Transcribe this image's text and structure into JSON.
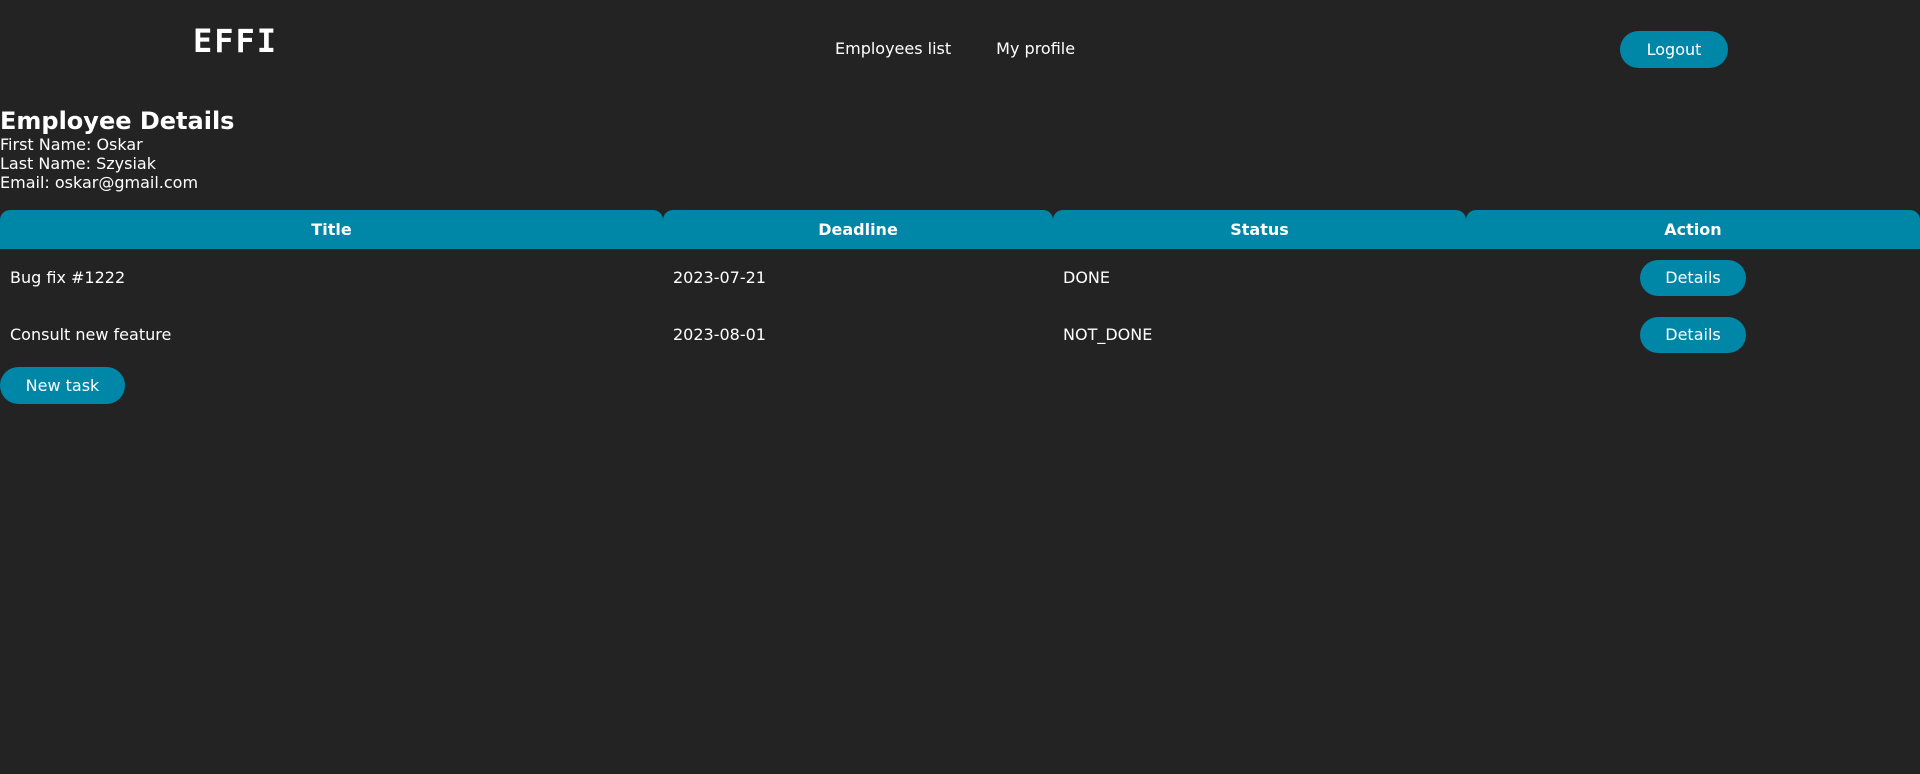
{
  "header": {
    "logo": "EFFI",
    "nav": [
      "Employees list",
      "My profile"
    ],
    "logout_label": "Logout"
  },
  "employee": {
    "title": "Employee Details",
    "first_name": "First Name: Oskar",
    "last_name": "Last Name: Szysiak",
    "email": "Email: oskar@gmail.com"
  },
  "tasks_table": {
    "headers": [
      "Title",
      "Deadline",
      "Status",
      "Action"
    ],
    "rows": [
      {
        "title": "Bug fix #1222",
        "deadline": "2023-07-21",
        "status": "DONE",
        "action": "Details"
      },
      {
        "title": "Consult new feature",
        "deadline": "2023-08-01",
        "status": "NOT_DONE",
        "action": "Details"
      }
    ]
  },
  "new_task_label": "New task",
  "colors": {
    "background": "#232323",
    "accent": "#0087a8",
    "text": "#ffffff"
  }
}
